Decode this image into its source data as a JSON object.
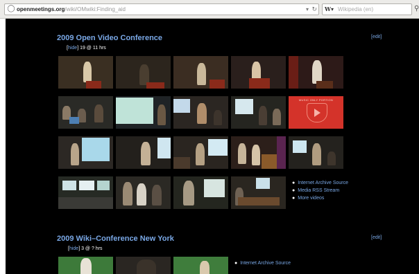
{
  "browser": {
    "url_domain": "openmeetings.org",
    "url_path": "/wiki/OMwiki:Finding_aid",
    "search_engine": "W",
    "search_placeholder": "Wikipedia (en)"
  },
  "sections": [
    {
      "title": "2009 Open Video Conference",
      "edit_label": "[edit]",
      "hide_label": "hide",
      "summary": "19 @ 11 hrs",
      "links": [
        "Internet Archive Source",
        "Media RSS Stream",
        "More videos"
      ]
    },
    {
      "title": "2009 Wiki–Conference New York",
      "edit_label": "[edit]",
      "hide_label": "hide",
      "summary": "3 @ ? hrs",
      "links": [
        "Internet Archive Source"
      ]
    }
  ],
  "red_thumb_text": "MUSIC ONLY PORTION"
}
